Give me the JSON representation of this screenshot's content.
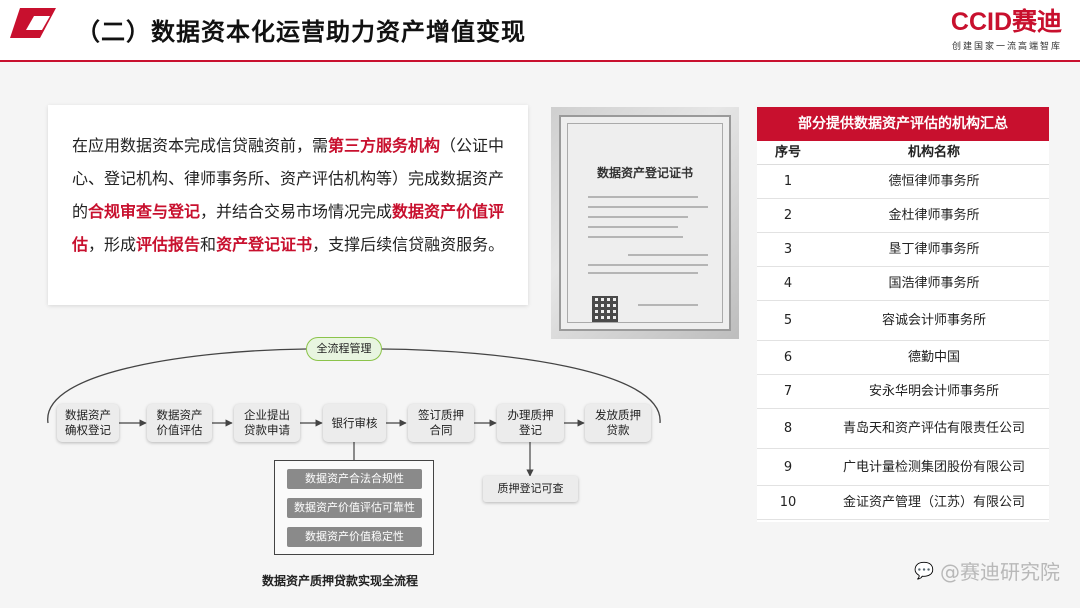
{
  "header": {
    "title": "（二）数据资本化运营助力资产增值变现",
    "logo_text": "CCID赛迪",
    "logo_slogan": "创建国家一流高端智库"
  },
  "intro": {
    "p1": "在应用数据资本完成信贷融资前，需",
    "h1": "第三方服务机构",
    "p2": "（公证中心、登记机构、律师事务所、资产评估机构等）完成数据资产的",
    "h2": "合规审查与登记",
    "p3": "，并结合交易市场情况完成",
    "h3": "数据资产价值评估",
    "p4": "，形成",
    "h4": "评估报告",
    "p5": "和",
    "h5": "资产登记证书",
    "p6": "，支撑后续信贷融资服务。"
  },
  "certificate": {
    "title": "数据资产登记证书"
  },
  "table": {
    "title": "部分提供数据资产评估的机构汇总",
    "col_no": "序号",
    "col_name": "机构名称",
    "rows": [
      {
        "no": "1",
        "name": "德恒律师事务所"
      },
      {
        "no": "2",
        "name": "金杜律师事务所"
      },
      {
        "no": "3",
        "name": "垦丁律师事务所"
      },
      {
        "no": "4",
        "name": "国浩律师事务所"
      },
      {
        "no": "5",
        "name": "容诚会计师事务所"
      },
      {
        "no": "6",
        "name": "德勤中国"
      },
      {
        "no": "7",
        "name": "安永华明会计师事务所"
      },
      {
        "no": "8",
        "name": "青岛天和资产评估有限责任公司"
      },
      {
        "no": "9",
        "name": "广电计量检测集团股份有限公司"
      },
      {
        "no": "10",
        "name": "金证资产管理（江苏）有限公司"
      }
    ]
  },
  "flow": {
    "loop_label": "全流程管理",
    "steps": [
      "数据资产\n确权登记",
      "数据资产\n价值评估",
      "企业提出\n贷款申请",
      "银行审核",
      "签订质押\n合同",
      "办理质押\n登记",
      "发放质押\n贷款"
    ],
    "sub_items": [
      "数据资产合法合规性",
      "数据资产价值评估可靠性",
      "数据资产价值稳定性"
    ],
    "pledge_check": "质押登记可查",
    "caption": "数据资产质押贷款实现全流程"
  },
  "watermark": "@赛迪研究院",
  "colors": {
    "accent": "#c8102e",
    "green": "#8bc34a"
  }
}
